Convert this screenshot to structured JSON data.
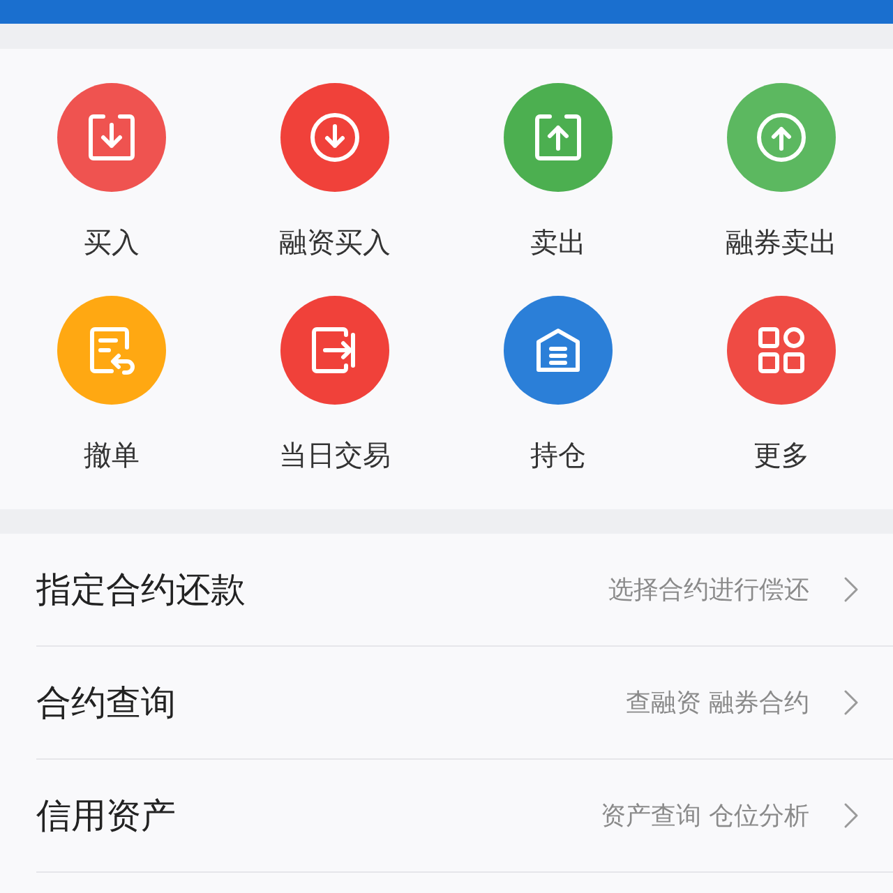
{
  "actions": [
    {
      "label": "买入",
      "color": "#ef5350"
    },
    {
      "label": "融资买入",
      "color": "#f0413a"
    },
    {
      "label": "卖出",
      "color": "#4caf50"
    },
    {
      "label": "融券卖出",
      "color": "#5cb860"
    },
    {
      "label": "撤单",
      "color": "#ffa812"
    },
    {
      "label": "当日交易",
      "color": "#f0413a"
    },
    {
      "label": "持仓",
      "color": "#2b7fd8"
    },
    {
      "label": "更多",
      "color": "#ef4b44"
    }
  ],
  "menu": [
    {
      "title": "指定合约还款",
      "hint": "选择合约进行偿还"
    },
    {
      "title": "合约查询",
      "hint": "查融资 融券合约"
    },
    {
      "title": "信用资产",
      "hint": "资产查询 仓位分析"
    }
  ]
}
